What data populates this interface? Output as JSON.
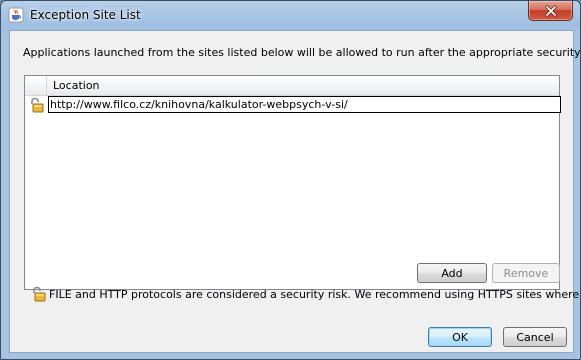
{
  "window": {
    "title": "Exception Site List",
    "title_icon": "java-cup-icon",
    "close_icon": "close-icon"
  },
  "description": "Applications launched from the sites listed below will be allowed to run after the appropriate security prompts.",
  "table": {
    "columns": [
      "",
      "Location"
    ],
    "rows": [
      {
        "icon": "unlocked-padlock-icon",
        "location": "http://www.filco.cz/knihovna/kalkulator-webpsych-v-si/"
      }
    ]
  },
  "buttons": {
    "add": "Add",
    "remove": "Remove",
    "ok": "OK",
    "cancel": "Cancel"
  },
  "warning": {
    "icon": "unlocked-padlock-icon",
    "text": "FILE and HTTP protocols are considered a security risk.  We recommend using HTTPS sites where available."
  },
  "colors": {
    "titlebar": "#a9c6e6",
    "close_button": "#c4402b",
    "client_background": "#f0f0f0",
    "default_button_border": "#3c7fb1"
  }
}
